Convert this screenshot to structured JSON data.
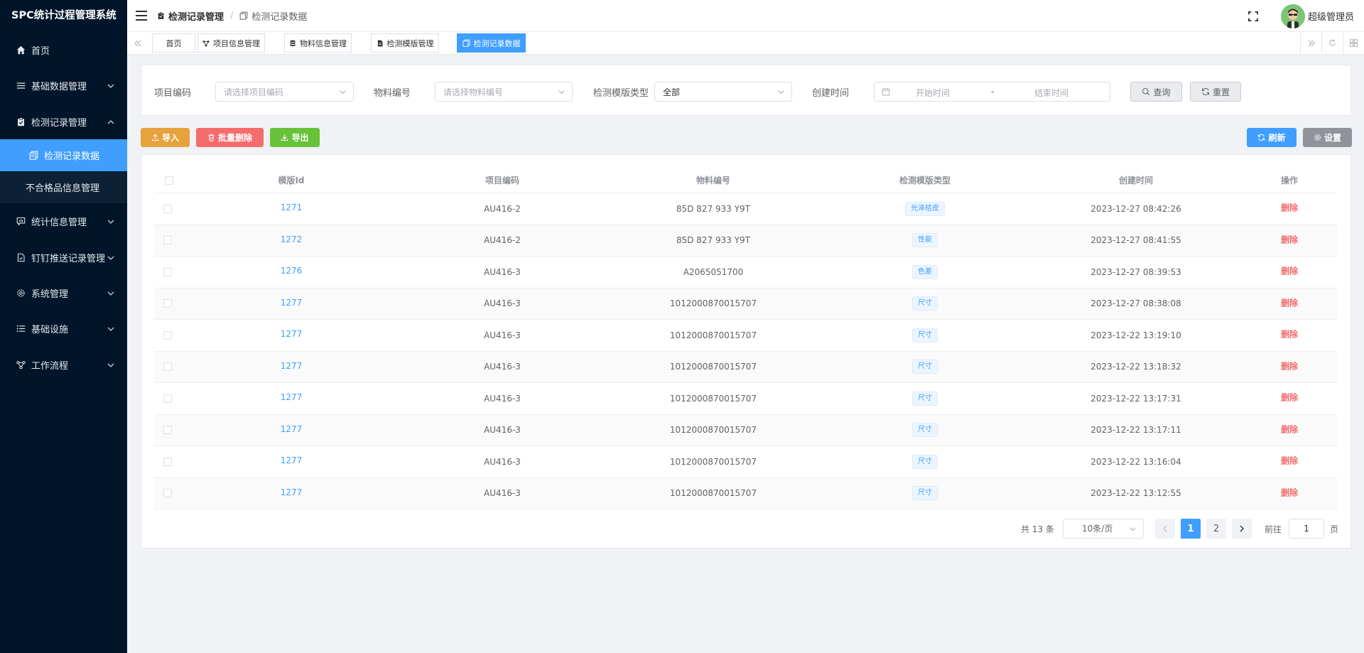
{
  "app": {
    "title": "SPC统计过程管理系统"
  },
  "sidebar": {
    "items": [
      {
        "label": "首页",
        "icon": "home-icon"
      },
      {
        "label": "基础数据管理",
        "icon": "list-icon"
      },
      {
        "label": "检测记录管理",
        "icon": "clipboard-check-icon",
        "expanded": true
      },
      {
        "label": "统计信息管理",
        "icon": "chat-chart-icon"
      },
      {
        "label": "钉钉推送记录管理",
        "icon": "document-icon"
      },
      {
        "label": "系统管理",
        "icon": "gear-icon"
      },
      {
        "label": "基础设施",
        "icon": "bullet-list-icon"
      },
      {
        "label": "工作流程",
        "icon": "flow-icon"
      }
    ],
    "sub_items": [
      {
        "label": "检测记录数据",
        "active": true
      },
      {
        "label": "不合格品信息管理",
        "active": false
      }
    ]
  },
  "header": {
    "breadcrumb": [
      "检测记录管理",
      "检测记录数据"
    ],
    "username": "超级管理员"
  },
  "tabs": [
    "首页",
    "项目信息管理",
    "物料信息管理",
    "检测模版管理",
    "检测记录数据"
  ],
  "search": {
    "project_label": "项目编码",
    "project_placeholder": "请选择项目编码",
    "material_label": "物料编号",
    "material_placeholder": "请选择物料编号",
    "template_type_label": "检测模版类型",
    "template_type_value": "全部",
    "created_label": "创建时间",
    "start_placeholder": "开始时间",
    "range_sep": "-",
    "end_placeholder": "结束时间",
    "query_label": "查询",
    "reset_label": "重置"
  },
  "toolbar": {
    "import_label": "导入",
    "batch_delete_label": "批量删除",
    "export_label": "导出",
    "refresh_label": "刷新",
    "settings_label": "设置"
  },
  "table": {
    "columns": [
      "模版Id",
      "项目编码",
      "物料编号",
      "检测模版类型",
      "创建时间",
      "操作"
    ],
    "rows": [
      {
        "id": "1271",
        "project": "AU416-2",
        "material": "85D 827 933 Y9T",
        "type": "光泽桔皮",
        "created": "2023-12-27 08:42:26",
        "action": "删除"
      },
      {
        "id": "1272",
        "project": "AU416-2",
        "material": "85D 827 933 Y9T",
        "type": "性能",
        "created": "2023-12-27 08:41:55",
        "action": "删除"
      },
      {
        "id": "1276",
        "project": "AU416-3",
        "material": "A2065051700",
        "type": "色差",
        "created": "2023-12-27 08:39:53",
        "action": "删除"
      },
      {
        "id": "1277",
        "project": "AU416-3",
        "material": "1012000870015707",
        "type": "尺寸",
        "created": "2023-12-27 08:38:08",
        "action": "删除"
      },
      {
        "id": "1277",
        "project": "AU416-3",
        "material": "1012000870015707",
        "type": "尺寸",
        "created": "2023-12-22 13:19:10",
        "action": "删除"
      },
      {
        "id": "1277",
        "project": "AU416-3",
        "material": "1012000870015707",
        "type": "尺寸",
        "created": "2023-12-22 13:18:32",
        "action": "删除"
      },
      {
        "id": "1277",
        "project": "AU416-3",
        "material": "1012000870015707",
        "type": "尺寸",
        "created": "2023-12-22 13:17:31",
        "action": "删除"
      },
      {
        "id": "1277",
        "project": "AU416-3",
        "material": "1012000870015707",
        "type": "尺寸",
        "created": "2023-12-22 13:17:11",
        "action": "删除"
      },
      {
        "id": "1277",
        "project": "AU416-3",
        "material": "1012000870015707",
        "type": "尺寸",
        "created": "2023-12-22 13:16:04",
        "action": "删除"
      },
      {
        "id": "1277",
        "project": "AU416-3",
        "material": "1012000870015707",
        "type": "尺寸",
        "created": "2023-12-22 13:12:55",
        "action": "删除"
      }
    ]
  },
  "pagination": {
    "total_text": "共 13 条",
    "page_size": "10条/页",
    "pages": [
      "1",
      "2"
    ],
    "current_page": "1",
    "goto_label": "前往",
    "goto_value": "1",
    "page_suffix": "页"
  },
  "colors": {
    "sidebar_bg": "#001529",
    "primary": "#409eff",
    "import": "#e6a23c",
    "danger": "#f56c6c",
    "success": "#67c23a",
    "info": "#909399"
  }
}
